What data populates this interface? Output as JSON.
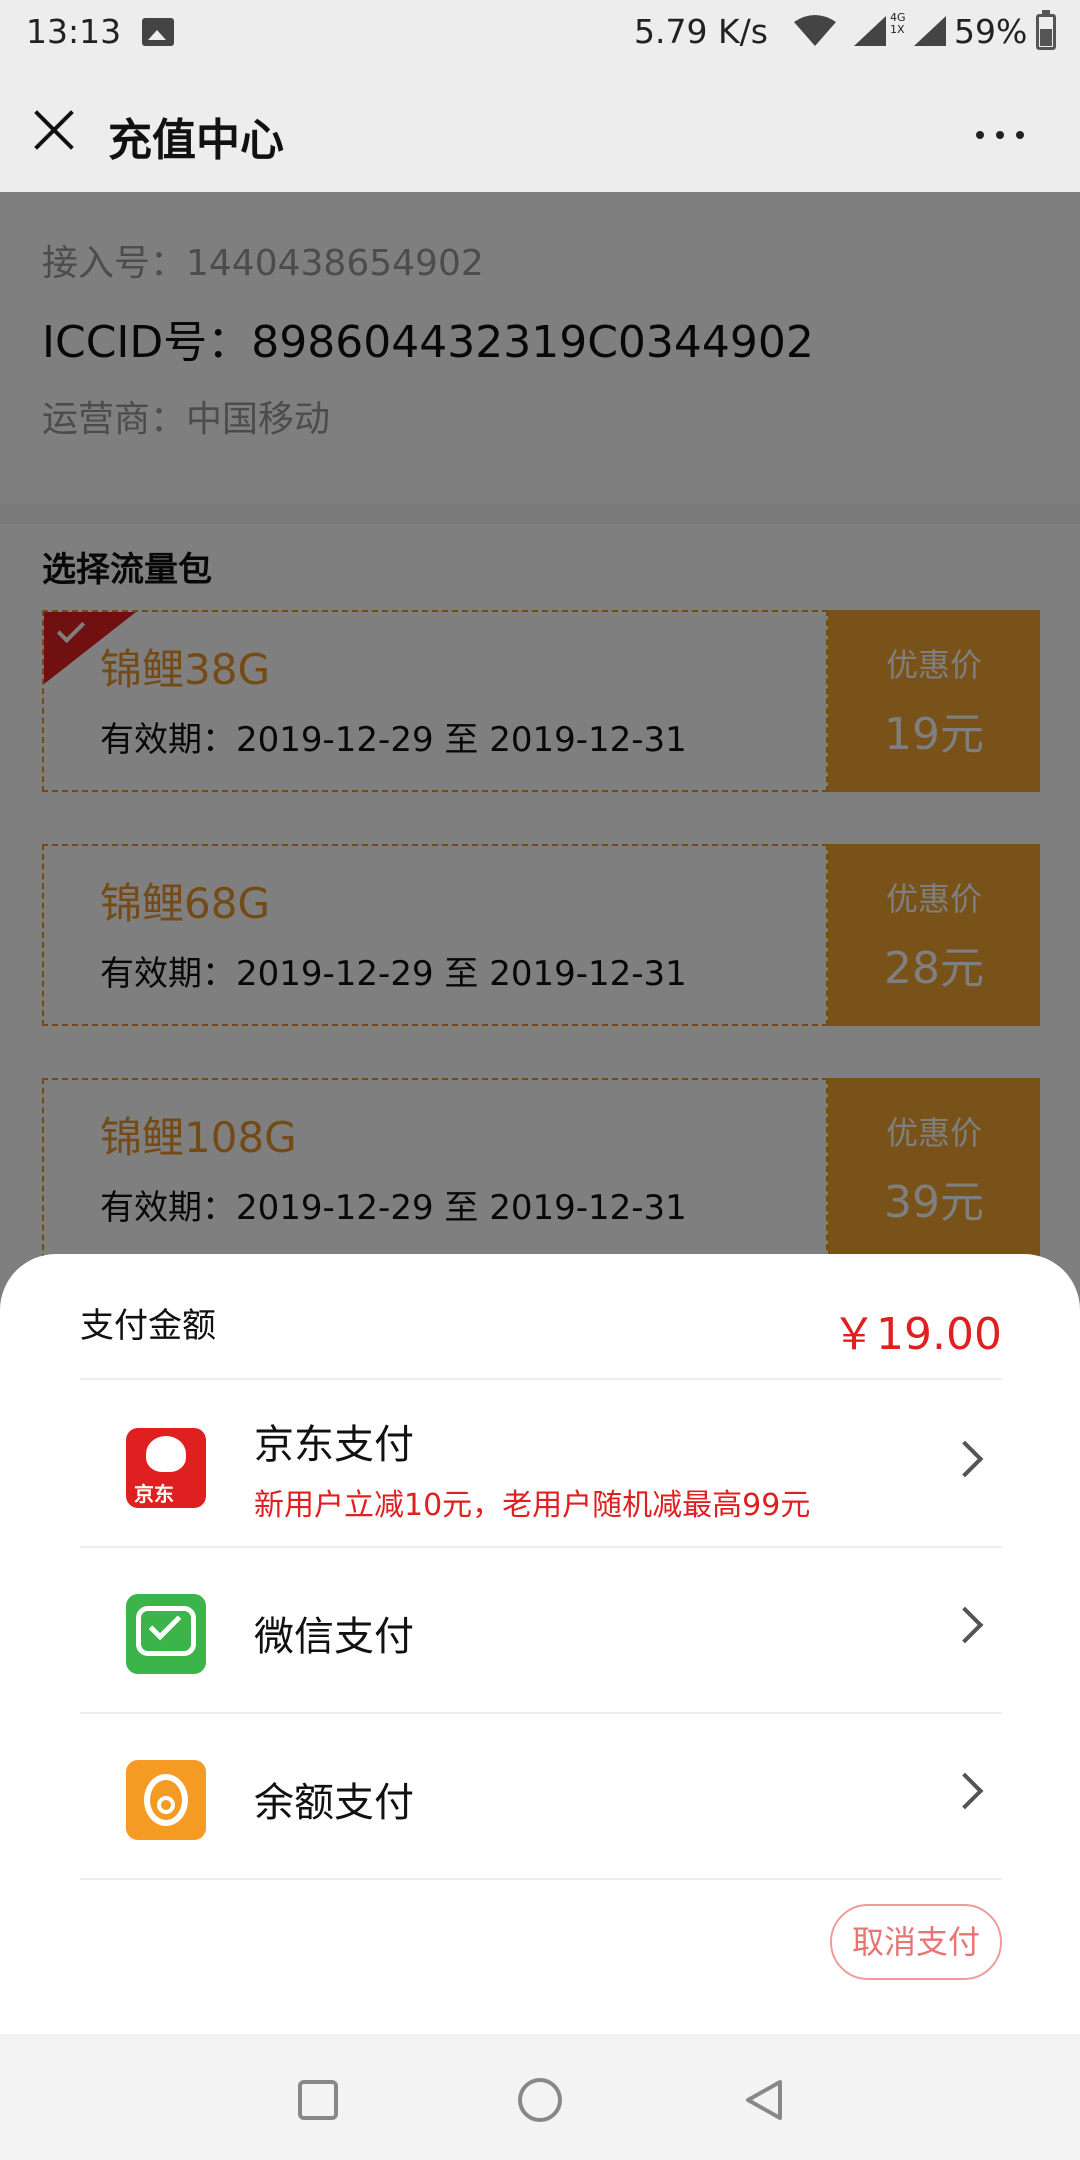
{
  "status_bar": {
    "time": "13:13",
    "speed": "5.79 K/s",
    "network": "4G\n1X",
    "battery": "59%"
  },
  "header": {
    "title": "充值中心"
  },
  "info": {
    "access_number": "接入号：1440438654902",
    "iccid": "ICCID号：898604432319C0344902",
    "operator": "运营商：中国移动"
  },
  "packages": {
    "section_title": "选择流量包",
    "items": [
      {
        "name": "锦鲤38G",
        "validity": "有效期：2019-12-29 至 2019-12-31",
        "price_label": "优惠价",
        "price": "19元"
      },
      {
        "name": "锦鲤68G",
        "validity": "有效期：2019-12-29 至 2019-12-31",
        "price_label": "优惠价",
        "price": "28元"
      },
      {
        "name": "锦鲤108G",
        "validity": "有效期：2019-12-29 至 2019-12-31",
        "price_label": "优惠价",
        "price": "39元"
      }
    ]
  },
  "payment": {
    "amount_label": "支付金额",
    "amount_value": "￥19.00",
    "methods": [
      {
        "label": "京东支付",
        "sub": "新用户立减10元，老用户随机减最高99元",
        "icon_text": "京东"
      },
      {
        "label": "微信支付"
      },
      {
        "label": "余额支付"
      }
    ],
    "cancel_label": "取消支付"
  },
  "colors": {
    "accent_orange": "#f0a432",
    "accent_red": "#e02020",
    "wechat_green": "#3bb54a",
    "balance_orange": "#f59a23"
  },
  "icons": [
    "close-icon",
    "more-icon",
    "jd-pay-icon",
    "wechat-pay-icon",
    "balance-pay-icon",
    "chevron-right-icon"
  ]
}
